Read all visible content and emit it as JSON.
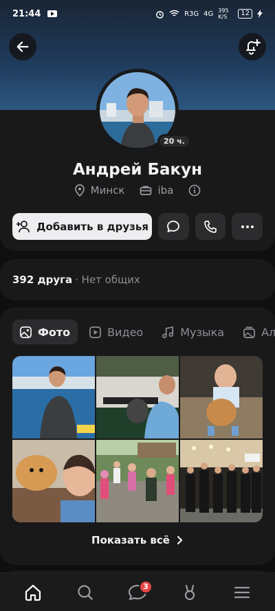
{
  "status_bar": {
    "time": "21:44",
    "network": "R3G",
    "signal2": "4G",
    "speed": "395 K/S",
    "battery": "12"
  },
  "profile": {
    "name": "Андрей Бакун",
    "last_seen": "20 ч.",
    "city": "Минск",
    "work": "iba"
  },
  "actions": {
    "add_friend": "Добавить в друзья"
  },
  "friends": {
    "count": "392 друга",
    "mutual": "· Нет общих"
  },
  "media_tabs": [
    "Фото",
    "Видео",
    "Музыка",
    "Ал"
  ],
  "photos_show_all": "Показать всё",
  "nav": {
    "messages_badge": "3"
  },
  "colors": {
    "accent_gradient_top": "#1a2535",
    "accent_gradient_bottom": "#2b5680",
    "badge": "#e64646"
  }
}
